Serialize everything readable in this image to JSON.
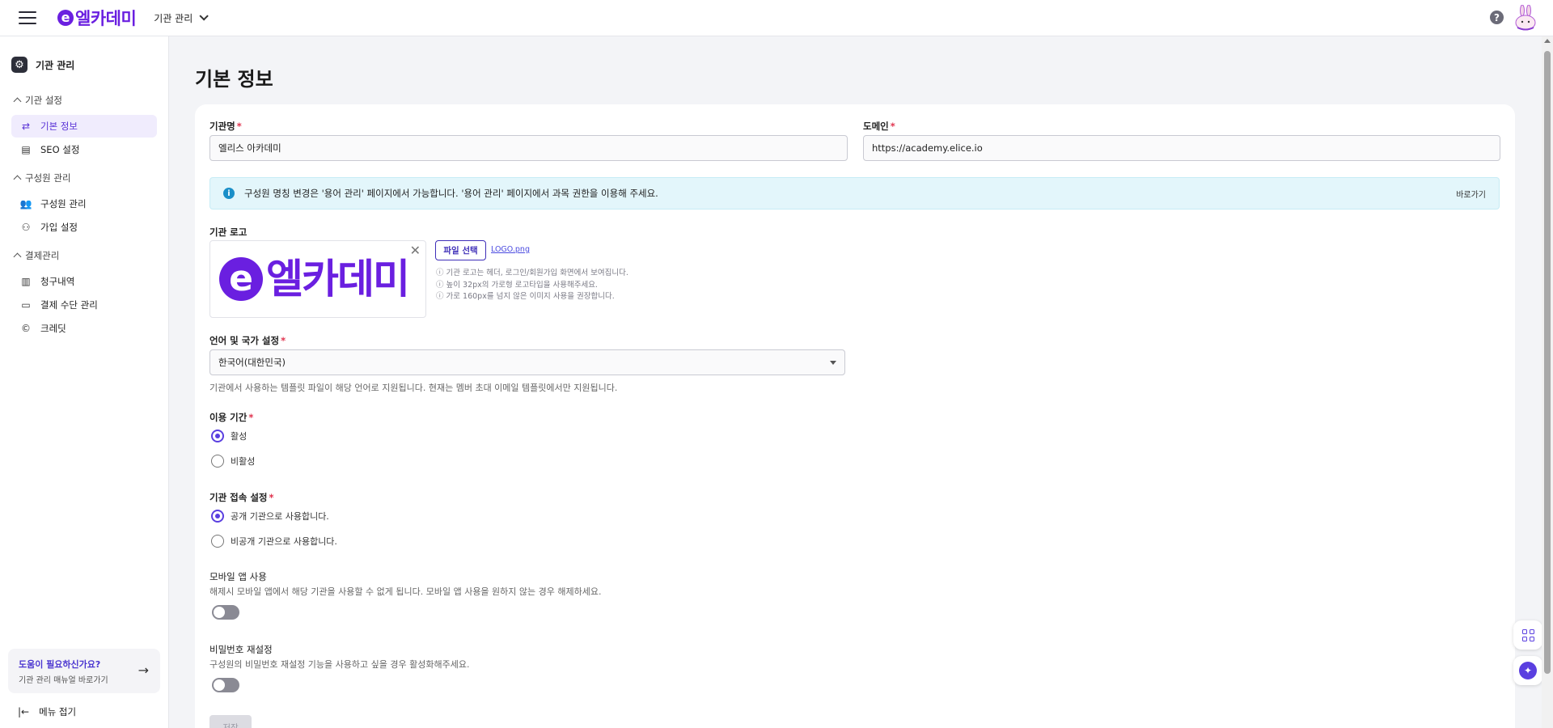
{
  "header": {
    "logo_mark": "e",
    "logo_text": "엘카데미",
    "org_selector": "기관 관리",
    "help_symbol": "?"
  },
  "sidebar": {
    "title": "기관 관리",
    "sections": [
      {
        "label": "기관 설정",
        "items": [
          {
            "label": "기본 정보",
            "icon": "swap-arrows-icon",
            "active": true
          },
          {
            "label": "SEO 설정",
            "icon": "seo-chart-icon",
            "active": false
          }
        ]
      },
      {
        "label": "구성원 관리",
        "items": [
          {
            "label": "구성원 관리",
            "icon": "users-icon",
            "active": false
          },
          {
            "label": "가입 설정",
            "icon": "user-add-icon",
            "active": false
          }
        ]
      },
      {
        "label": "결제관리",
        "items": [
          {
            "label": "청구내역",
            "icon": "receipt-icon",
            "active": false
          },
          {
            "label": "결제 수단 관리",
            "icon": "card-icon",
            "active": false
          },
          {
            "label": "크레딧",
            "icon": "copyright-icon",
            "active": false
          }
        ]
      }
    ],
    "help_card": {
      "title": "도움이 필요하신가요?",
      "subtitle": "기관 관리 매뉴얼 바로가기"
    },
    "collapse_label": "메뉴 접기"
  },
  "main": {
    "page_title": "기본 정보",
    "org_name": {
      "label": "기관명",
      "value": "엘리스 아카데미"
    },
    "domain": {
      "label": "도메인",
      "value": "https://academy.elice.io"
    },
    "info": {
      "text": "구성원 명칭 변경은 '용어 관리' 페이지에서 가능합니다. '용어 관리' 페이지에서 과목 권한을 이용해 주세요.",
      "link": "바로가기"
    },
    "logo": {
      "label": "기관 로고",
      "preview_mark": "e",
      "preview_text": "엘카데미",
      "file_button": "파일 선택",
      "file_name": "LOGO.png",
      "hints": [
        "기관 로고는 헤더, 로그인/회원가입 화면에서 보여집니다.",
        "높이 32px의 가로형 로고타입을 사용해주세요.",
        "가로 160px를 넘지 않은 이미지 사용을 권장합니다."
      ]
    },
    "language": {
      "label": "언어 및 국가 설정",
      "value": "한국어(대한민국)",
      "desc": "기관에서 사용하는 템플릿 파일이 해당 언어로 지원됩니다. 현재는 멤버 초대 이메일 템플릿에서만 지원됩니다."
    },
    "period": {
      "label": "이용 기간",
      "options": [
        "활성",
        "비활성"
      ],
      "selected": 0
    },
    "access": {
      "label": "기관 접속 설정",
      "options": [
        "공개 기관으로 사용합니다.",
        "비공개 기관으로 사용합니다."
      ],
      "selected": 0
    },
    "mobile": {
      "label": "모바일 앱 사용",
      "desc": "해제시 모바일 앱에서 해당 기관을 사용할 수 없게 됩니다. 모바일 앱 사용을 원하지 않는 경우 해제하세요.",
      "enabled": false
    },
    "password": {
      "label": "비밀번호 재설정",
      "desc": "구성원의 비밀번호 재설정 기능을 사용하고 싶을 경우 활성화해주세요.",
      "enabled": false
    },
    "save_label": "저장"
  },
  "colors": {
    "brand": "#6a1fe0",
    "accent": "#5a3fe0",
    "required": "#e0344f",
    "info_bg": "#e3f6fb"
  }
}
